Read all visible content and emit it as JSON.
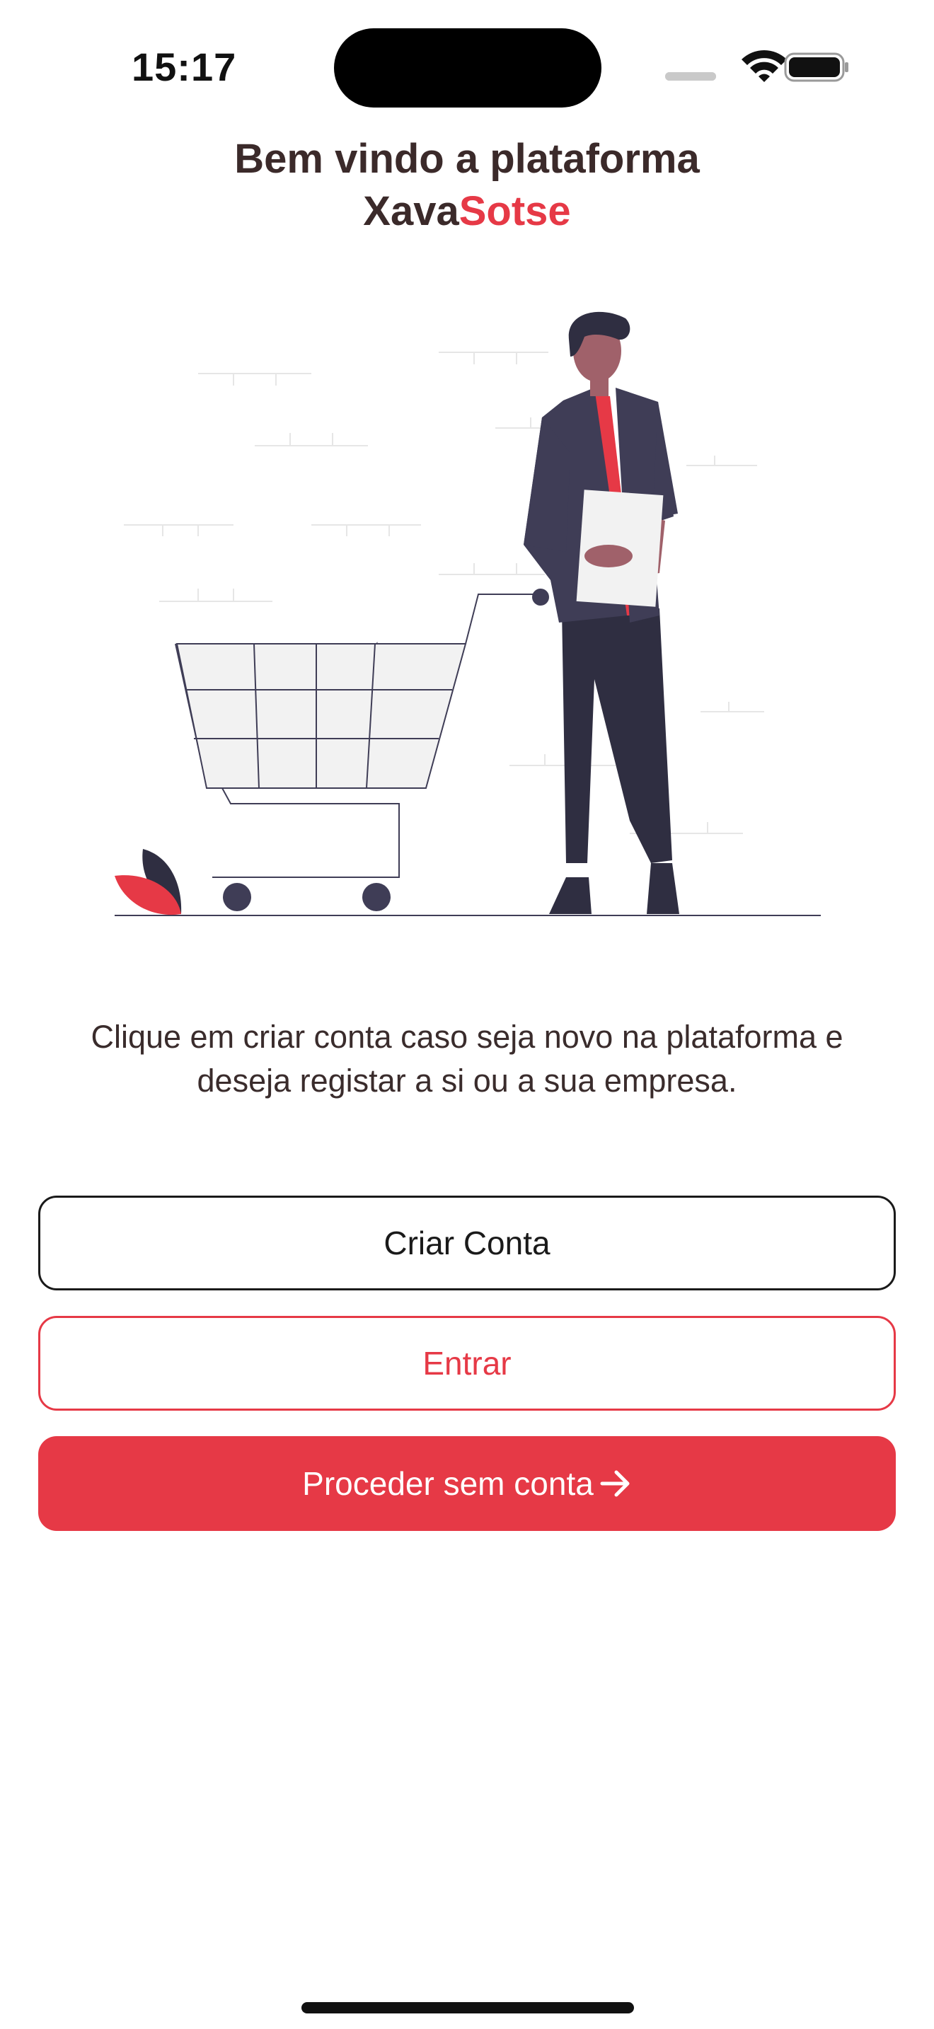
{
  "status_bar": {
    "time": "15:17",
    "icons": [
      "signal-icon",
      "wifi-icon",
      "battery-icon"
    ]
  },
  "welcome": {
    "title_line1": "Bem vindo a plataforma",
    "brand_part1": "Xava",
    "brand_part2": "Sotse"
  },
  "illustration": {
    "name": "shopping-cart-person-illustration"
  },
  "description": "Clique em criar conta caso seja novo na plataforma e deseja registar a si ou a sua empresa.",
  "actions": {
    "create_account_label": "Criar Conta",
    "login_label": "Entrar",
    "proceed_label": "Proceder sem conta",
    "proceed_icon": "arrow-right-icon"
  },
  "colors": {
    "accent": "#e63946",
    "title_text": "#3b2a2a",
    "dark": "#2f2e41"
  }
}
